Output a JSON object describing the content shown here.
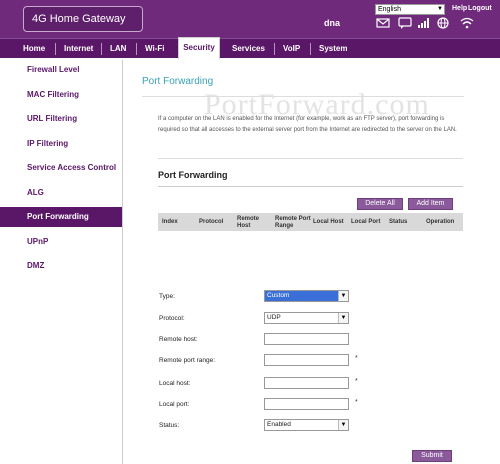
{
  "header": {
    "brand": "4G Home Gateway",
    "user": "dna",
    "language": "English",
    "help": "Help",
    "logout": "Logout",
    "icons": [
      "mail-icon",
      "sms-icon",
      "signal-icon",
      "globe-icon",
      "wifi-icon"
    ]
  },
  "nav": {
    "items": [
      "Home",
      "Internet",
      "LAN",
      "Wi-Fi",
      "Security",
      "Services",
      "VoIP",
      "System"
    ],
    "active": "Security"
  },
  "sidebar": {
    "items": [
      "Firewall Level",
      "MAC Filtering",
      "URL Filtering",
      "IP Filtering",
      "Service Access Control",
      "ALG",
      "Port Forwarding",
      "UPnP",
      "DMZ"
    ],
    "active": "Port Forwarding"
  },
  "main": {
    "title": "Port Forwarding",
    "watermark": "PortForward.com",
    "description": "If a computer on the LAN is enabled for the Internet (for example, work as an FTP server), port forwarding is required so that all accesses to the external server port from the Internet are redirected to the server on the LAN.",
    "section_title": "Port Forwarding",
    "buttons": {
      "delete_all": "Delete All",
      "add_item": "Add Item"
    },
    "table_headers": [
      "Index",
      "Protocol",
      "Remote Host",
      "Remote Port Range",
      "Local Host",
      "Local Port",
      "Status",
      "Operation"
    ],
    "form": {
      "type_label": "Type:",
      "type_value": "Custom",
      "protocol_label": "Protocol:",
      "protocol_value": "UDP",
      "remote_host_label": "Remote host:",
      "remote_host_value": "",
      "remote_port_range_label": "Remote port range:",
      "remote_port_range_value": "",
      "local_host_label": "Local host:",
      "local_host_value": "",
      "local_port_label": "Local port:",
      "local_port_value": "",
      "status_label": "Status:",
      "status_value": "Enabled",
      "required_mark": "*",
      "submit": "Submit"
    }
  },
  "colors": {
    "brand_purple": "#5a1768",
    "header_purple": "#6f2a7c",
    "title_teal": "#3aa1b5",
    "button_purple": "#8a5a9b"
  }
}
